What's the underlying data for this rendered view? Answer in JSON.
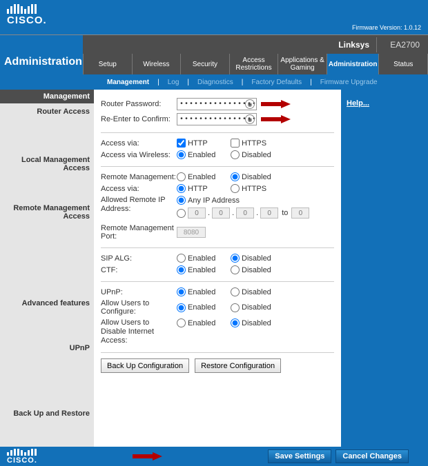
{
  "firmware": "Firmware Version: 1.0.12",
  "brand": "Linksys",
  "model": "EA2700",
  "page_title": "Administration",
  "nav": {
    "setup": "Setup",
    "wireless": "Wireless",
    "security": "Security",
    "access": "Access Restrictions",
    "apps": "Applications & Gaming",
    "admin": "Administration",
    "status": "Status"
  },
  "subnav": {
    "management": "Management",
    "log": "Log",
    "diagnostics": "Diagnostics",
    "factory": "Factory Defaults",
    "firmware": "Firmware Upgrade"
  },
  "left": {
    "header": "Management",
    "router_access": "Router Access",
    "local": "Local Management Access",
    "remote": "Remote Management Access",
    "advanced": "Advanced features",
    "upnp": "UPnP",
    "backup": "Back Up and Restore"
  },
  "help": "Help...",
  "labels": {
    "router_password": "Router Password:",
    "reenter": "Re-Enter to Confirm:",
    "access_via": "Access via:",
    "access_wireless": "Access via Wireless:",
    "remote_mgmt": "Remote  Management:",
    "allowed_ip": "Allowed Remote IP Address:",
    "any_ip": "Any IP Address",
    "remote_port": "Remote Management Port:",
    "sip": "SIP ALG:",
    "ctf": "CTF:",
    "upnp": "UPnP:",
    "upnp_configure": "Allow Users to Configure:",
    "upnp_disable": "Allow Users to Disable Internet Access:",
    "to": "to"
  },
  "options": {
    "http": "HTTP",
    "https": "HTTPS",
    "enabled": "Enabled",
    "disabled": "Disabled"
  },
  "values": {
    "password_mask": "••••••••••••••••",
    "ip1": "0",
    "ip2": "0",
    "ip3": "0",
    "ip4": "0",
    "ip5": "0",
    "port": "8080"
  },
  "selections": {
    "local_http": true,
    "local_https": false,
    "local_wireless": "enabled",
    "remote_mgmt": "disabled",
    "remote_via": "http",
    "remote_ip_any": true,
    "sip": "disabled",
    "ctf": "enabled",
    "upnp": "enabled",
    "upnp_configure": "enabled",
    "upnp_disable": "disabled"
  },
  "buttons": {
    "backup": "Back Up Configuration",
    "restore": "Restore Configuration",
    "save": "Save Settings",
    "cancel": "Cancel Changes"
  }
}
